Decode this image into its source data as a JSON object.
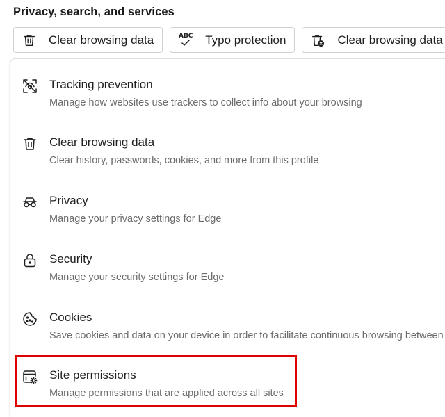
{
  "section": {
    "title": "Privacy, search, and services"
  },
  "quick_actions": [
    {
      "label": "Clear browsing data",
      "icon": "trash-icon"
    },
    {
      "label": "Typo protection",
      "icon": "abc-check-icon",
      "icon_text": "ABC"
    },
    {
      "label": "Clear browsing data",
      "icon": "trash-clear-icon"
    }
  ],
  "items": [
    {
      "title": "Tracking prevention",
      "description": "Manage how websites use trackers to collect info about your browsing",
      "icon": "tracking-prevention-icon"
    },
    {
      "title": "Clear browsing data",
      "description": "Clear history, passwords, cookies, and more from this profile",
      "icon": "trash-icon"
    },
    {
      "title": "Privacy",
      "description": "Manage your privacy settings for Edge",
      "icon": "glasses-icon"
    },
    {
      "title": "Security",
      "description": "Manage your security settings for Edge",
      "icon": "lock-icon"
    },
    {
      "title": "Cookies",
      "description": "Save cookies and data on your device in order to facilitate continuous browsing between visits",
      "icon": "cookie-icon"
    },
    {
      "title": "Site permissions",
      "description": "Manage permissions that are applied across all sites",
      "icon": "site-permissions-icon"
    }
  ],
  "colors": {
    "highlight": "#e00000",
    "text_primary": "#1f1f1f",
    "text_secondary": "#6b6b6b"
  }
}
